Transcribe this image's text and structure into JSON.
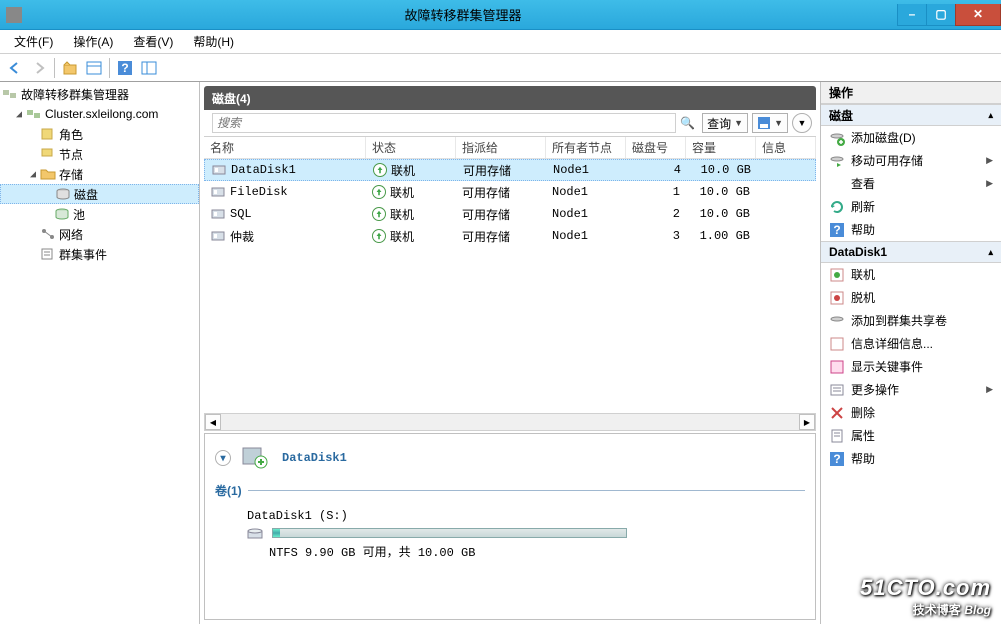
{
  "window": {
    "title": "故障转移群集管理器"
  },
  "menu": {
    "file": "文件(F)",
    "action": "操作(A)",
    "view": "查看(V)",
    "help": "帮助(H)"
  },
  "tree": {
    "root": "故障转移群集管理器",
    "cluster": "Cluster.sxleilong.com",
    "roles": "角色",
    "nodes": "节点",
    "storage": "存储",
    "disks": "磁盘",
    "pools": "池",
    "networks": "网络",
    "events": "群集事件"
  },
  "center": {
    "title": "磁盘(4)",
    "search_placeholder": "搜索",
    "query_btn": "查询",
    "headers": {
      "name": "名称",
      "status": "状态",
      "assigned": "指派给",
      "owner": "所有者节点",
      "diskno": "磁盘号",
      "capacity": "容量",
      "info": "信息"
    },
    "rows": [
      {
        "name": "DataDisk1",
        "status": "联机",
        "assigned": "可用存储",
        "owner": "Node1",
        "diskno": "4",
        "capacity": "10.0 GB"
      },
      {
        "name": "FileDisk",
        "status": "联机",
        "assigned": "可用存储",
        "owner": "Node1",
        "diskno": "1",
        "capacity": "10.0 GB"
      },
      {
        "name": "SQL",
        "status": "联机",
        "assigned": "可用存储",
        "owner": "Node1",
        "diskno": "2",
        "capacity": "10.0 GB"
      },
      {
        "name": "仲裁",
        "status": "联机",
        "assigned": "可用存储",
        "owner": "Node1",
        "diskno": "3",
        "capacity": "1.00 GB"
      }
    ]
  },
  "detail": {
    "name": "DataDisk1",
    "volumes_title": "卷(1)",
    "vol_label": "DataDisk1 (S:)",
    "vol_text": "NTFS 9.90 GB 可用，共 10.00 GB"
  },
  "actions": {
    "pane_title": "操作",
    "disk_panel": "磁盘",
    "add_disk": "添加磁盘(D)",
    "move_storage": "移动可用存储",
    "view": "查看",
    "refresh": "刷新",
    "help": "帮助",
    "sel_panel": "DataDisk1",
    "online": "联机",
    "offline": "脱机",
    "add_csv": "添加到群集共享卷",
    "info_detail": "信息详细信息...",
    "critical_events": "显示关键事件",
    "more_actions": "更多操作",
    "delete": "删除",
    "properties": "属性",
    "help2": "帮助"
  },
  "watermark": {
    "big": "51CTO.com",
    "small": "技术博客",
    "blog": "Blog"
  }
}
